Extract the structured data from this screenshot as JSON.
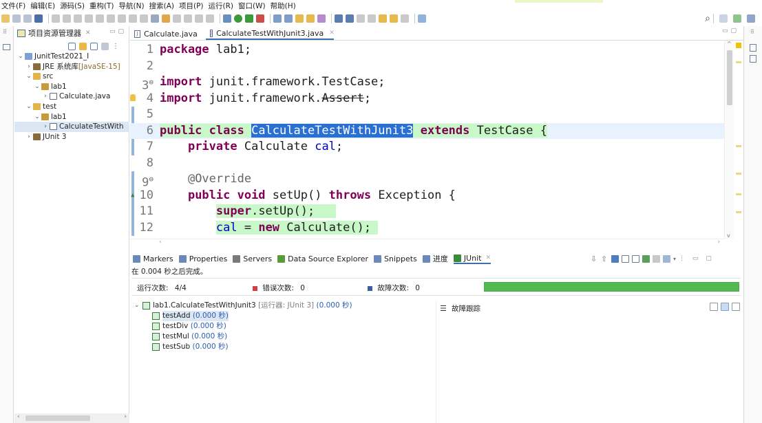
{
  "menu": [
    "文件(F)",
    "编辑(E)",
    "源码(S)",
    "重构(T)",
    "导航(N)",
    "搜索(A)",
    "项目(P)",
    "运行(R)",
    "窗口(W)",
    "帮助(H)"
  ],
  "explorer": {
    "title": "项目资源管理器",
    "tree": [
      {
        "label": "JunitTest2021_I",
        "decoration": "",
        "level": 0,
        "expanded": true,
        "icon": "project-icon"
      },
      {
        "label": "JRE 系统库",
        "decoration": "[JavaSE-15]",
        "level": 1,
        "expanded": false,
        "icon": "library-icon"
      },
      {
        "label": "src",
        "decoration": "",
        "level": 1,
        "expanded": true,
        "icon": "source-folder-icon"
      },
      {
        "label": "lab1",
        "decoration": "",
        "level": 2,
        "expanded": true,
        "icon": "package-icon"
      },
      {
        "label": "Calculate.java",
        "decoration": "",
        "level": 3,
        "expanded": false,
        "icon": "java-file-icon"
      },
      {
        "label": "test",
        "decoration": "",
        "level": 1,
        "expanded": true,
        "icon": "source-folder-icon"
      },
      {
        "label": "lab1",
        "decoration": "",
        "level": 2,
        "expanded": true,
        "icon": "package-icon"
      },
      {
        "label": "CalculateTestWith",
        "decoration": "",
        "level": 3,
        "expanded": false,
        "icon": "java-file-icon",
        "selected": true
      },
      {
        "label": "JUnit 3",
        "decoration": "",
        "level": 1,
        "expanded": false,
        "icon": "library-icon"
      }
    ]
  },
  "editor": {
    "tabs": [
      {
        "label": "Calculate.java",
        "active": false
      },
      {
        "label": "CalculateTestWithJunit3.java",
        "active": true
      }
    ],
    "lines": [
      {
        "n": "1",
        "parts": [
          {
            "t": "package",
            "c": "kw"
          },
          {
            "t": " lab1;",
            "c": ""
          }
        ]
      },
      {
        "n": "2",
        "parts": []
      },
      {
        "n": "3",
        "fold": true,
        "parts": [
          {
            "t": "import",
            "c": "kw"
          },
          {
            "t": " junit.framework.TestCase;",
            "c": ""
          }
        ]
      },
      {
        "n": "4",
        "bulb": true,
        "parts": [
          {
            "t": "import",
            "c": "kw"
          },
          {
            "t": " junit.framework.",
            "c": ""
          },
          {
            "t": "Assert",
            "c": "strike"
          },
          {
            "t": ";",
            "c": ""
          }
        ]
      },
      {
        "n": "5",
        "parts": []
      },
      {
        "n": "6",
        "current": true,
        "parts": [
          {
            "t": "public class",
            "c": "kw green-bg"
          },
          {
            "t": " ",
            "c": "green-bg"
          },
          {
            "t": "CalculateTestWithJunit3",
            "c": "sel"
          },
          {
            "t": " ",
            "c": "green-bg"
          },
          {
            "t": "extends",
            "c": "kw green-bg"
          },
          {
            "t": " TestCase {",
            "c": "green-bg"
          }
        ]
      },
      {
        "n": "7",
        "parts": [
          {
            "t": "    ",
            "c": ""
          },
          {
            "t": "private",
            "c": "kw"
          },
          {
            "t": " Calculate ",
            "c": ""
          },
          {
            "t": "cal",
            "c": "fld"
          },
          {
            "t": ";",
            "c": ""
          }
        ]
      },
      {
        "n": "8",
        "parts": []
      },
      {
        "n": "9",
        "fold": true,
        "parts": [
          {
            "t": "    ",
            "c": ""
          },
          {
            "t": "@Override",
            "c": "ann"
          }
        ]
      },
      {
        "n": "10",
        "override": true,
        "parts": [
          {
            "t": "    ",
            "c": ""
          },
          {
            "t": "public void",
            "c": "kw"
          },
          {
            "t": " setUp() ",
            "c": ""
          },
          {
            "t": "throws",
            "c": "kw"
          },
          {
            "t": " Exception {",
            "c": ""
          }
        ]
      },
      {
        "n": "11",
        "parts": [
          {
            "t": "        ",
            "c": ""
          },
          {
            "t": "super",
            "c": "kw green-bg"
          },
          {
            "t": ".setUp();",
            "c": "green-bg"
          },
          {
            "t": "   ",
            "c": "green-bg"
          }
        ]
      },
      {
        "n": "12",
        "parts": [
          {
            "t": "        ",
            "c": ""
          },
          {
            "t": "cal",
            "c": "fld green-bg"
          },
          {
            "t": " = ",
            "c": "green-bg"
          },
          {
            "t": "new",
            "c": "kw green-bg"
          },
          {
            "t": " Calculate(); ",
            "c": "green-bg"
          }
        ]
      }
    ]
  },
  "bottom_panel": {
    "tabs": [
      {
        "label": "Markers",
        "icon": "markers-icon"
      },
      {
        "label": "Properties",
        "icon": "properties-icon"
      },
      {
        "label": "Servers",
        "icon": "servers-icon"
      },
      {
        "label": "Data Source Explorer",
        "icon": "data-source-icon"
      },
      {
        "label": "Snippets",
        "icon": "snippets-icon"
      },
      {
        "label": "进度",
        "icon": "progress-icon"
      },
      {
        "label": "JUnit",
        "icon": "junit-icon",
        "active": true
      }
    ],
    "status": "在 0.004 秒之后完成。",
    "counters": {
      "runs_label": "运行次数:",
      "runs_value": "4/4",
      "errors_label": "错误次数:",
      "errors_value": "0",
      "failures_label": "故障次数:",
      "failures_value": "0"
    },
    "progress_fraction": 1.0,
    "progress_color": "#52b852",
    "results": [
      {
        "name": "lab1.CalculateTestWithJunit3",
        "meta": "[运行器: JUnit 3]",
        "time": "(0.000 秒)",
        "level": 0
      },
      {
        "name": "testAdd",
        "meta": "",
        "time": "(0.000 秒)",
        "level": 1,
        "selected": true
      },
      {
        "name": "testDiv",
        "meta": "",
        "time": "(0.000 秒)",
        "level": 1
      },
      {
        "name": "testMul",
        "meta": "",
        "time": "(0.000 秒)",
        "level": 1
      },
      {
        "name": "testSub",
        "meta": "",
        "time": "(0.000 秒)",
        "level": 1
      }
    ],
    "failure_trace_label": "故障跟踪"
  }
}
